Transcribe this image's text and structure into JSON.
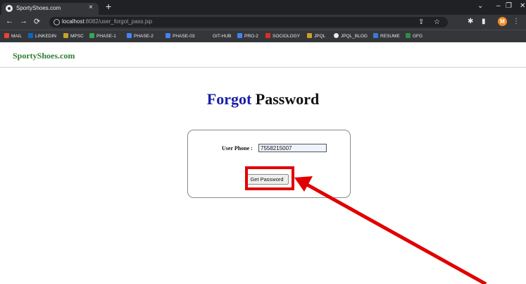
{
  "browser": {
    "tab_title": "SportyShoes.com",
    "tab_close": "×",
    "new_tab": "+",
    "url_host": "localhost",
    "url_path": ":8082/user_forgot_pass.jsp",
    "profile_initial": "M",
    "bookmarks": [
      "MAIL",
      "LINKEDIN",
      "MPSC",
      "PHASE-1",
      "PHASE-2",
      "PHASE-03",
      "GIT-HUB",
      "PRO-2",
      "SOCIOLOGY",
      "JPQL",
      "JPQL_BLOG",
      "RESUME",
      "GFG"
    ]
  },
  "site": {
    "brand": "SportyShoes.com"
  },
  "heading": {
    "accent": "Forgot",
    "rest": "Password"
  },
  "form": {
    "phone_label": "User Phone :",
    "phone_value": "7558215007",
    "submit_label": "Get Password"
  },
  "colors": {
    "brand": "#2e7d32",
    "heading_accent": "#1a1fa8",
    "annotation": "#e00000"
  }
}
